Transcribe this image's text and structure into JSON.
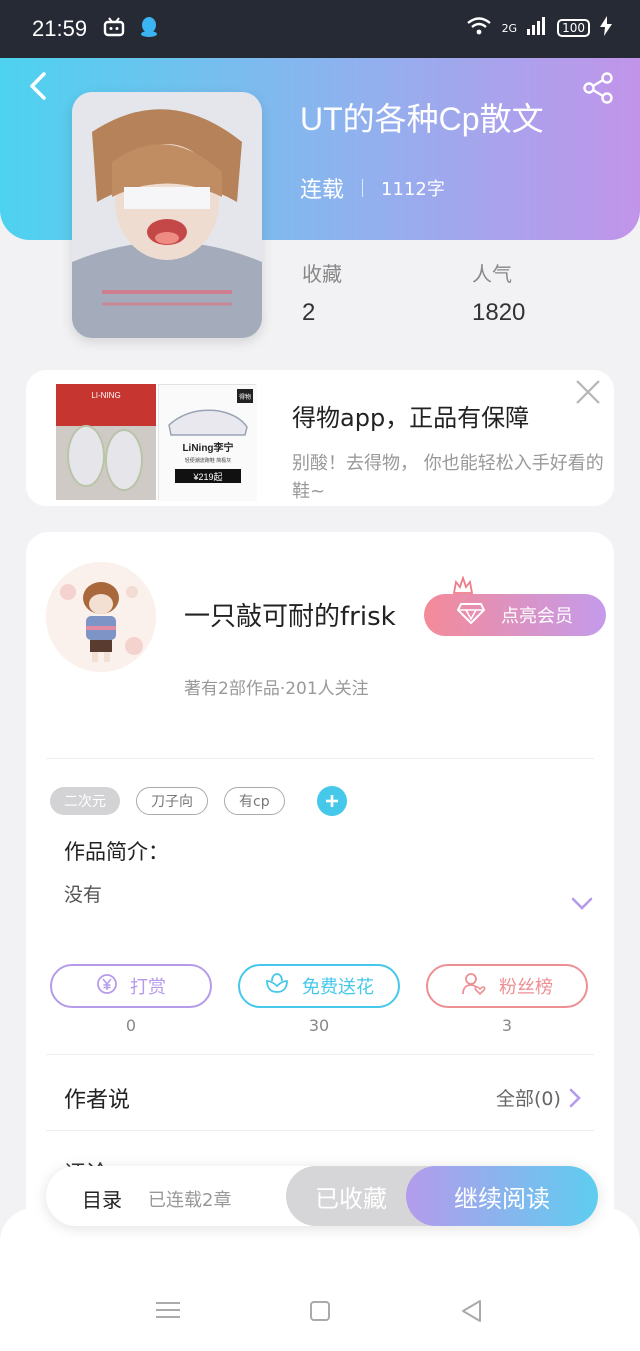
{
  "status_bar": {
    "time": "21:59",
    "network": "2G",
    "battery": "100"
  },
  "book": {
    "title": "UT的各种Cp散文",
    "status": "连载",
    "words": "1112字",
    "stats": [
      {
        "label": "收藏",
        "value": "2"
      },
      {
        "label": "人气",
        "value": "1820"
      }
    ]
  },
  "ad": {
    "title": "得物app，正品有保障",
    "description": "别酸！去得物， 你也能轻松入手好看的鞋~",
    "brand_text": "LiNing李宁",
    "sub_text": "轻便潮流跑鞋 简极灰",
    "price": "¥219起",
    "top_label": "LI-NING",
    "corner_label": "得物"
  },
  "author": {
    "name": "一只敲可耐的frisk",
    "vip_label": "点亮会员",
    "meta": "著有2部作品·201人关注"
  },
  "tags": [
    "二次元",
    "刀子向",
    "有cp"
  ],
  "intro": {
    "label": "作品简介：",
    "text": "没有"
  },
  "actions": [
    {
      "label": "打赏",
      "count": "0",
      "color": "#b59bea"
    },
    {
      "label": "免费送花",
      "count": "30",
      "color": "#46c8ea"
    },
    {
      "label": "粉丝榜",
      "count": "3",
      "color": "#ee8f94"
    }
  ],
  "author_say": {
    "label": "作者说",
    "link": "全部(0)"
  },
  "comments": {
    "label": "评论"
  },
  "bottom_bar": {
    "toc": "目录",
    "chapters": "已连载2章",
    "collected": "已收藏",
    "continue": "继续阅读"
  }
}
